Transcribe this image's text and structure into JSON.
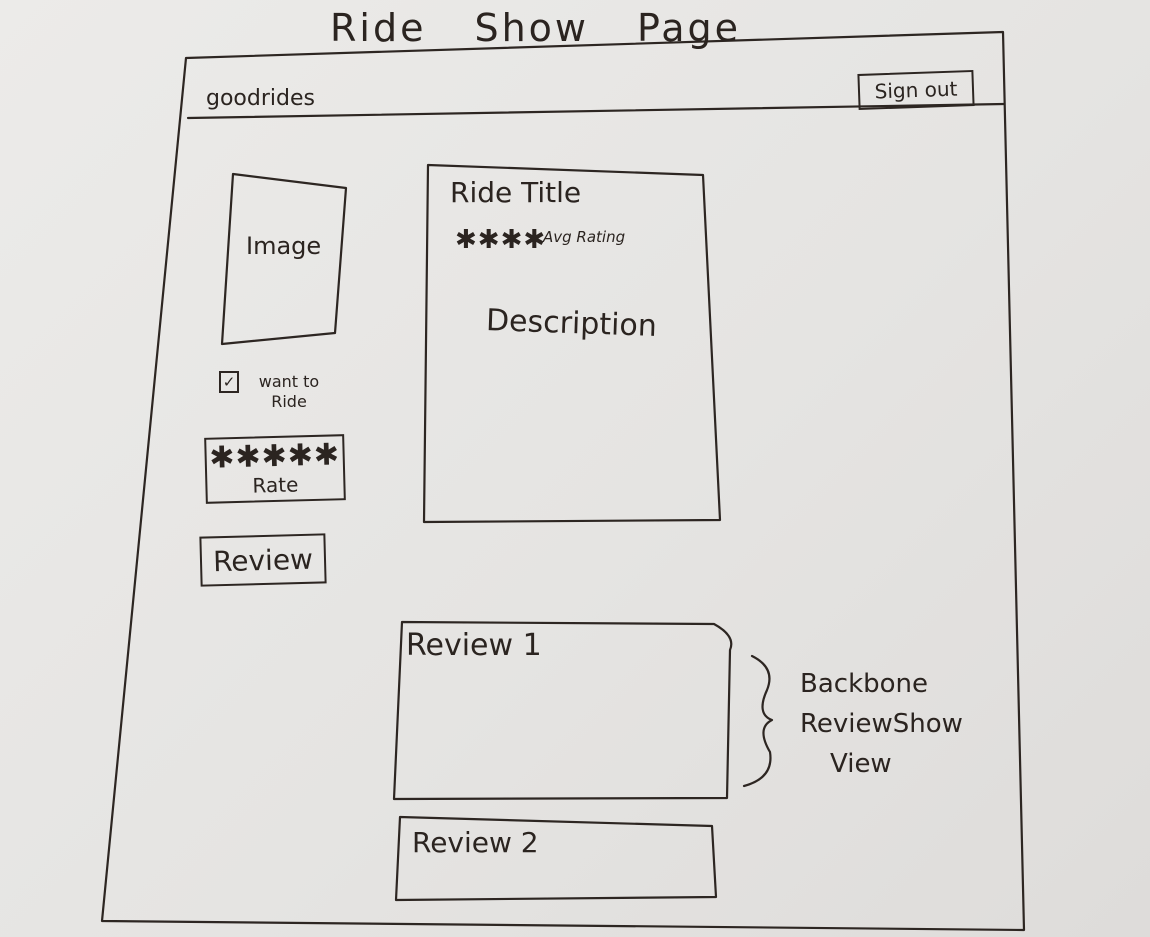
{
  "page_title": [
    "Ride",
    "Show",
    "Page"
  ],
  "header": {
    "brand": "goodrides",
    "sign_out_label": "Sign out"
  },
  "sidebar": {
    "image_label": "Image",
    "checkbox_mark": "✓",
    "want_to_ride_label": "want to Ride",
    "rate_stars": "✱✱✱✱✱",
    "rate_label": "Rate",
    "review_button_label": "Review"
  },
  "ride": {
    "title": "Ride Title",
    "avg_stars": "✱✱✱✱",
    "avg_rating_label": "Avg Rating",
    "description": "Description"
  },
  "reviews": [
    {
      "label": "Review 1"
    },
    {
      "label": "Review 2"
    }
  ],
  "annotation": [
    "Backbone",
    "ReviewShow",
    "View"
  ]
}
